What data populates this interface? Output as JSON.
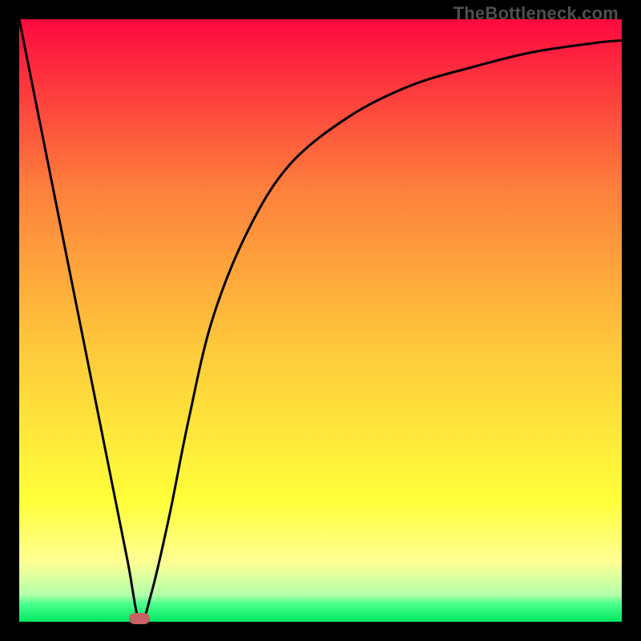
{
  "watermark": "TheBottleneck.com",
  "colors": {
    "top": "#fd093e",
    "upper": "#fd7f3c",
    "mid": "#feca3b",
    "lower_yellow": "#ffff39",
    "pale_yellow": "#ffff94",
    "pale_green": "#b3ffa9",
    "green": "#00e762",
    "curve": "#000000",
    "marker": "#c96262",
    "frame": "#000000"
  },
  "chart_data": {
    "type": "line",
    "title": "",
    "xlabel": "",
    "ylabel": "",
    "xlim": [
      0,
      100
    ],
    "ylim": [
      0,
      100
    ],
    "series": [
      {
        "name": "bottleneck-curve",
        "x": [
          0,
          5,
          10,
          15,
          18,
          20,
          22,
          25,
          28,
          32,
          38,
          45,
          55,
          65,
          75,
          85,
          95,
          100
        ],
        "y": [
          100,
          75,
          50,
          25,
          10,
          0,
          5,
          18,
          33,
          50,
          65,
          76,
          84,
          89,
          92,
          94.5,
          96,
          96.5
        ]
      }
    ],
    "annotations": [
      {
        "name": "min-marker",
        "x": 20,
        "y": 0.5
      }
    ],
    "gradient_stops": [
      {
        "pos": 0.0,
        "color": "#fd093e"
      },
      {
        "pos": 0.28,
        "color": "#fd7f3c"
      },
      {
        "pos": 0.55,
        "color": "#feca3b"
      },
      {
        "pos": 0.8,
        "color": "#ffff39"
      },
      {
        "pos": 0.9,
        "color": "#ffff94"
      },
      {
        "pos": 0.955,
        "color": "#b3ffa9"
      },
      {
        "pos": 0.97,
        "color": "#4dff8d"
      },
      {
        "pos": 1.0,
        "color": "#00e762"
      }
    ]
  }
}
